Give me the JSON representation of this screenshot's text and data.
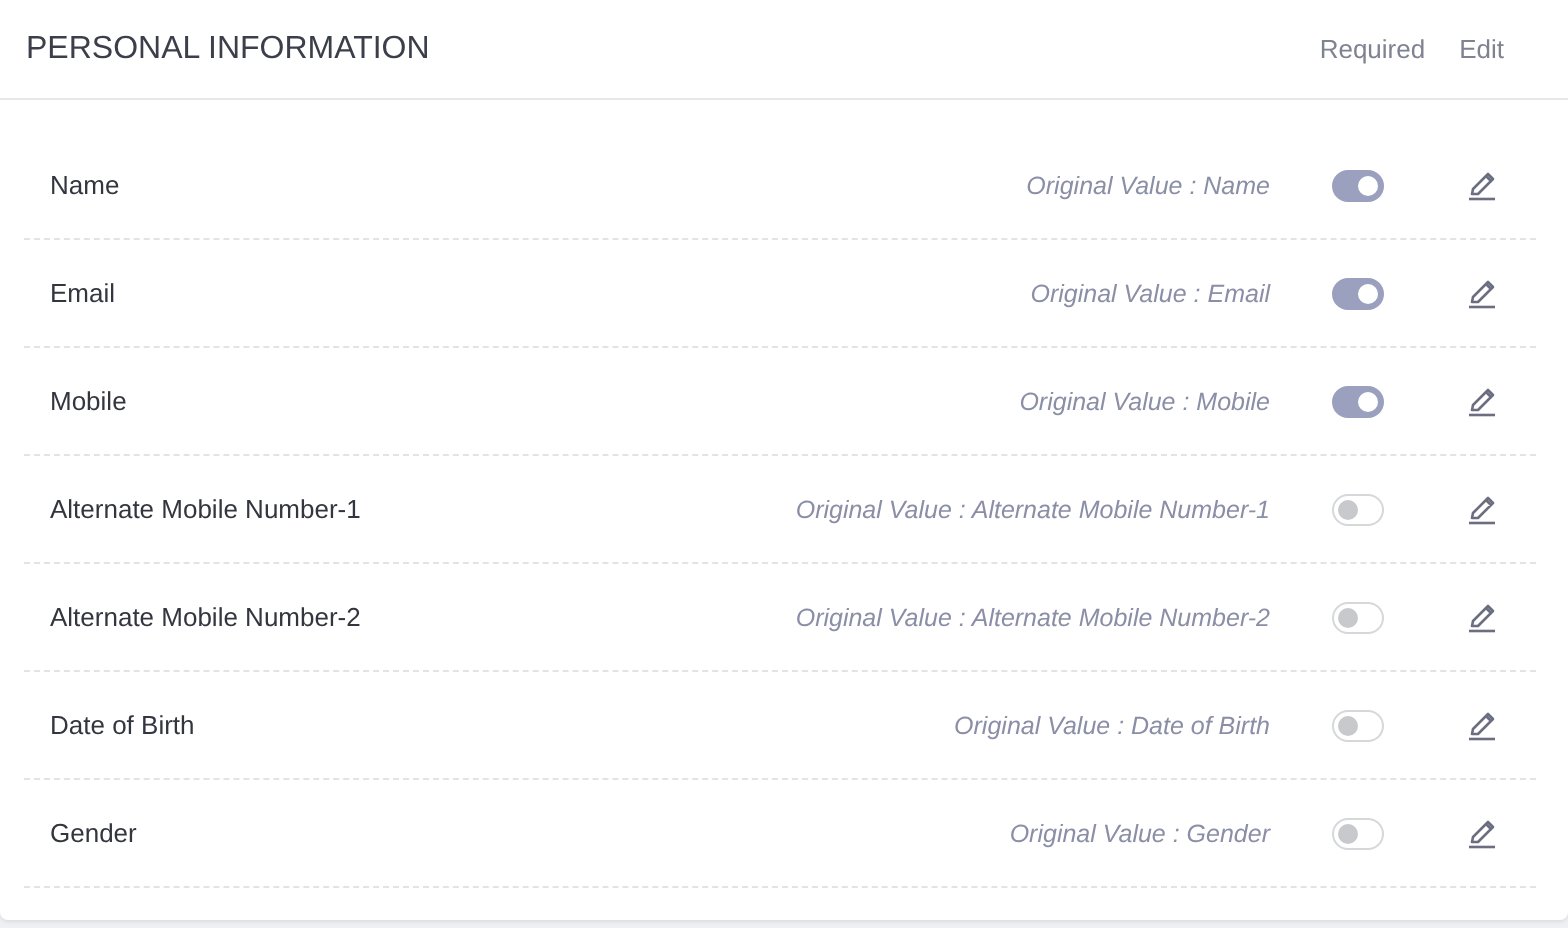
{
  "header": {
    "title": "PERSONAL INFORMATION",
    "columns": [
      "Required",
      "Edit"
    ]
  },
  "fields": [
    {
      "label": "Name",
      "original_value": "Original Value : Name",
      "required": true
    },
    {
      "label": "Email",
      "original_value": "Original Value : Email",
      "required": true
    },
    {
      "label": "Mobile",
      "original_value": "Original Value : Mobile",
      "required": true
    },
    {
      "label": "Alternate Mobile Number-1",
      "original_value": "Original Value : Alternate Mobile Number-1",
      "required": false
    },
    {
      "label": "Alternate Mobile Number-2",
      "original_value": "Original Value : Alternate Mobile Number-2",
      "required": false
    },
    {
      "label": "Date of Birth",
      "original_value": "Original Value : Date of Birth",
      "required": false
    },
    {
      "label": "Gender",
      "original_value": "Original Value : Gender",
      "required": false
    }
  ]
}
